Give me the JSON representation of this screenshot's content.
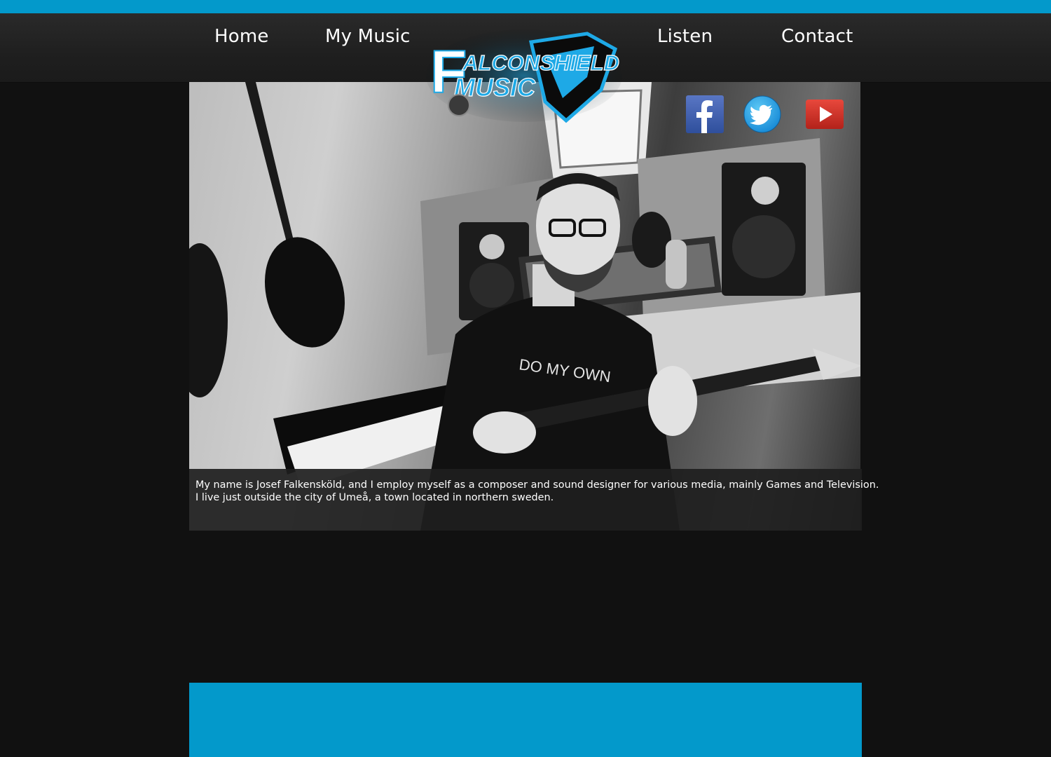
{
  "nav": {
    "home": "Home",
    "my_music": "My Music",
    "listen": "Listen",
    "contact": "Contact"
  },
  "logo": {
    "line1": "ALCONSHIELD",
    "initial": "F",
    "line2": "MUSIC"
  },
  "social": {
    "facebook_icon": "facebook-icon",
    "twitter_icon": "twitter-icon",
    "youtube_icon": "youtube-icon"
  },
  "hero": {
    "caption_line1": "My name is Josef Falkensköld, and I employ myself as a composer and sound designer for various media, mainly Games and Television.",
    "caption_line2": "I live just outside the city of Umeå, a town located in northern sweden."
  },
  "colors": {
    "accent": "#0399cb",
    "background": "#111111",
    "nav_bg": "#222222"
  }
}
